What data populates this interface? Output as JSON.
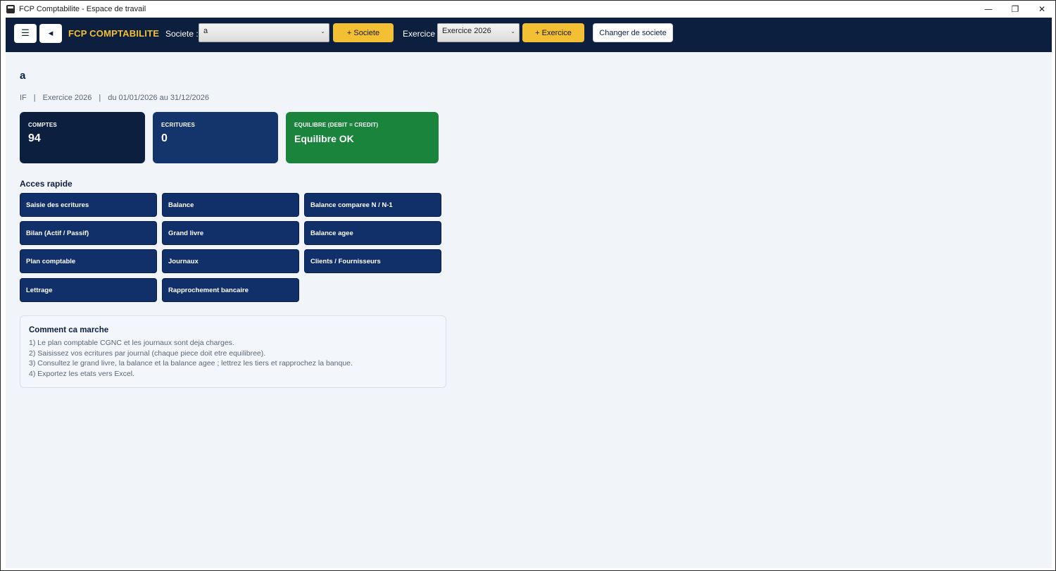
{
  "window": {
    "title": "FCP Comptabilite - Espace de travail",
    "controls": {
      "minimize": "—",
      "restore": "❐",
      "close": "✕"
    }
  },
  "toolbar": {
    "menu_icon": "☰",
    "back_icon": "◂",
    "brand": "FCP COMPTABILITE",
    "societe_label": "Societe :",
    "societe_value": "a",
    "add_societe_label": "+ Societe",
    "exercice_label": "Exercice :",
    "exercice_value": "Exercice 2026",
    "add_exercice_label": "+ Exercice",
    "change_societe_label": "Changer de societe",
    "caret": "⌄"
  },
  "company": {
    "name": "a",
    "code": "IF",
    "separator": "|",
    "exercice": "Exercice 2026",
    "period": "du 01/01/2026 au 31/12/2026"
  },
  "stats": [
    {
      "label": "COMPTES",
      "value": "94",
      "color": "#0c1f3f"
    },
    {
      "label": "ECRITURES",
      "value": "0",
      "color": "#14356b"
    },
    {
      "label": "EQUILIBRE (DEBIT = CREDIT)",
      "value": "Equilibre OK",
      "color": "#1a833c"
    }
  ],
  "quick_access": {
    "title": "Acces rapide",
    "items": [
      "Saisie des ecritures",
      "Balance",
      "Balance comparee N / N-1",
      "Bilan (Actif / Passif)",
      "Grand livre",
      "Balance agee",
      "Plan comptable",
      "Journaux",
      "Clients / Fournisseurs",
      "Lettrage",
      "Rapprochement bancaire"
    ]
  },
  "help": {
    "title": "Comment ca marche",
    "lines": [
      "1) Le plan comptable CGNC et les journaux sont deja charges.",
      "2) Saisissez vos ecritures par journal (chaque piece doit etre equilibree).",
      "3) Consultez le grand livre, la balance et la balance agee ; lettrez les tiers et rapprochez la banque.",
      "4) Exportez les etats vers Excel."
    ]
  },
  "colors": {
    "navy": "#0c1f3f",
    "accent_yellow": "#f3c033",
    "button_navy": "#11306a",
    "success_green": "#1a833c",
    "background": "#f1f4f8"
  }
}
